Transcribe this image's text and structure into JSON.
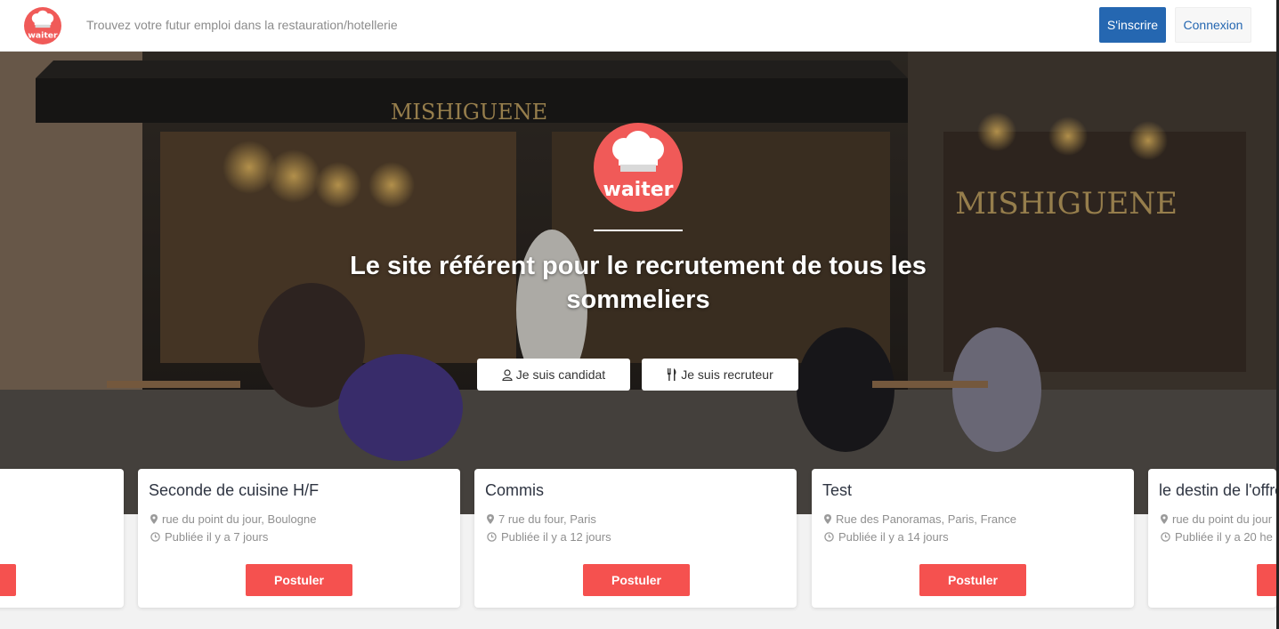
{
  "brand": {
    "logo_text": "waiter",
    "color": "#f05a58"
  },
  "header": {
    "tagline": "Trouvez votre futur emploi dans la restauration/hotellerie",
    "signup_label": "S'inscrire",
    "login_label": "Connexion",
    "signup_color": "#2567b1"
  },
  "hero": {
    "title": "Le site référent pour le recrutement de tous les sommeliers",
    "storefront_sign": "MISHIGUENE",
    "candidate_label": "Je suis candidat",
    "recruiter_label": "Je suis recruteur",
    "candidate_icon": "user-icon",
    "recruiter_icon": "utensils-icon"
  },
  "jobs": [
    {
      "title": "",
      "address": "",
      "published": "",
      "apply_label": ""
    },
    {
      "title": "Seconde de cuisine H/F",
      "address": "rue du point du jour, Boulogne",
      "published": "Publiée il y a 7 jours",
      "apply_label": "Postuler"
    },
    {
      "title": "Commis",
      "address": "7 rue du four, Paris",
      "published": "Publiée il y a 12 jours",
      "apply_label": "Postuler"
    },
    {
      "title": "Test",
      "address": "Rue des Panoramas, Paris, France",
      "published": "Publiée il y a 14 jours",
      "apply_label": "Postuler"
    },
    {
      "title": "le destin de l'offre",
      "address": "rue du point du jour",
      "published": "Publiée il y a 20 he",
      "apply_label": ""
    }
  ],
  "colors": {
    "apply_button": "#f5514f",
    "card_title": "#2f3542"
  }
}
